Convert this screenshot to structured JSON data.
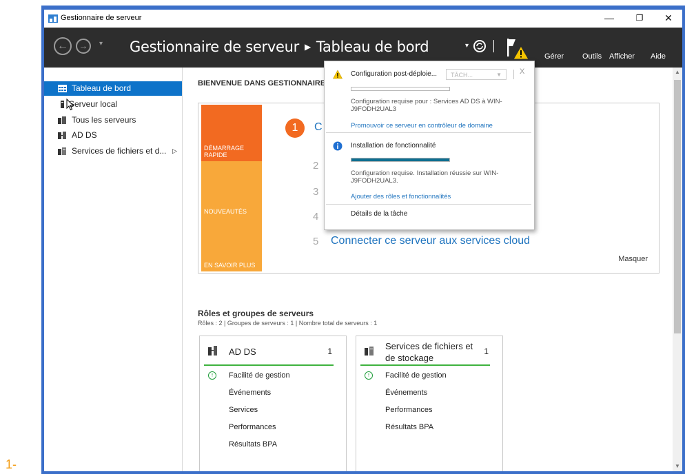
{
  "page_label": "1-",
  "window": {
    "title": "Gestionnaire de serveur",
    "controls": {
      "minimize": "—",
      "maximize": "❐",
      "close": "✕"
    }
  },
  "header": {
    "app_name": "Gestionnaire de serveur",
    "separator": "▶",
    "page": "Tableau de bord",
    "menu": [
      "Gérer",
      "Outils",
      "Afficher",
      "Aide"
    ],
    "icons": [
      "back-arrow-icon",
      "forward-arrow-icon",
      "refresh-icon",
      "notification-flag-icon",
      "warning-icon"
    ]
  },
  "sidebar": {
    "items": [
      {
        "label": "Tableau de bord",
        "icon": "dashboard-icon",
        "active": true
      },
      {
        "label": "Serveur local",
        "icon": "server-icon",
        "active": false
      },
      {
        "label": "Tous les serveurs",
        "icon": "servers-icon",
        "active": false
      },
      {
        "label": "AD DS",
        "icon": "ad-ds-icon",
        "active": false
      },
      {
        "label": "Services de fichiers et d...",
        "icon": "file-services-icon",
        "active": false,
        "arrow": "▷"
      }
    ]
  },
  "main": {
    "welcome": "BIENVENUE DANS GESTIONNAIRE DE SERVEUR",
    "tiles": [
      "DÉMARRAGE RAPIDE",
      "NOUVEAUTÉS",
      "EN SAVOIR PLUS"
    ],
    "steps": [
      {
        "num": "1",
        "label": "C"
      },
      {
        "num": "2",
        "label": ""
      },
      {
        "num": "3",
        "label": ""
      },
      {
        "num": "4",
        "label": ""
      },
      {
        "num": "5",
        "label": "Connecter ce serveur aux services cloud"
      }
    ],
    "hide": "Masquer",
    "roles_title": "Rôles et groupes de serveurs",
    "roles_summary": "Rôles : 2  |  Groupes de serveurs : 1  |  Nombre total de serveurs : 1",
    "cards": [
      {
        "title": "AD DS",
        "count": "1",
        "rows": [
          "Facilité de gestion",
          "Événements",
          "Services",
          "Performances",
          "Résultats BPA"
        ]
      },
      {
        "title": "Services de fichiers et de stockage",
        "count": "1",
        "rows": [
          "Facilité de gestion",
          "Événements",
          "Performances",
          "Résultats BPA"
        ]
      }
    ]
  },
  "popup": {
    "task1": {
      "title": "Configuration post-déploie...",
      "dropdown": "TÂCH...",
      "close": "X",
      "progress": 0,
      "description": "Configuration requise pour : Services AD DS à WIN-J9FODH2UAL3",
      "link": "Promouvoir ce serveur en contrôleur de domaine"
    },
    "task2": {
      "title": "Installation de fonctionnalité",
      "progress": 1.0,
      "description": "Configuration requise. Installation réussie sur WIN-J9FODH2UAL3.",
      "link": "Ajouter des rôles et fonctionnalités"
    },
    "details": "Détails de la tâche"
  },
  "colors": {
    "accent": "#0e73c9",
    "header_bg": "#2d2d2d",
    "tile_orange": "#f26a21",
    "tile_yellow": "#f8a83a",
    "status_green": "#3eb23e",
    "link_blue": "#1e73be"
  }
}
